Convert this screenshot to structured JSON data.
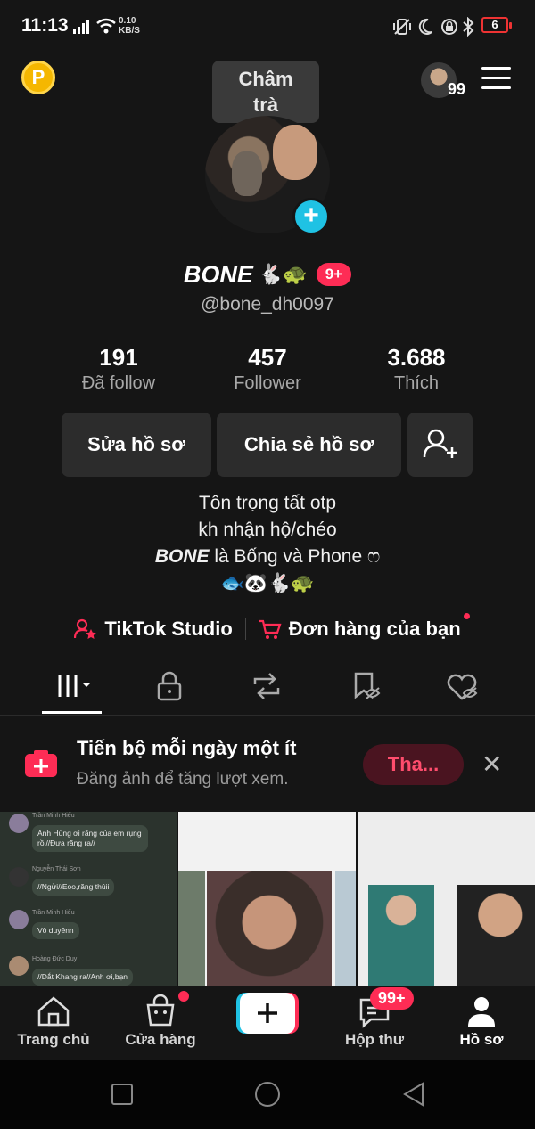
{
  "status_bar": {
    "time": "11:13",
    "speed_value": "0.10",
    "speed_unit": "KB/S",
    "battery": "6"
  },
  "header": {
    "coin_label": "P",
    "tooltip_line1": "Châm",
    "tooltip_line2": "trà",
    "following_count": "99"
  },
  "profile": {
    "name": "BONE",
    "name_emoji": "🐇🐢",
    "badge": "9+",
    "handle": "@bone_dh0097",
    "stats": [
      {
        "value": "191",
        "label": "Đã follow"
      },
      {
        "value": "457",
        "label": "Follower"
      },
      {
        "value": "3.688",
        "label": "Thích"
      }
    ],
    "buttons": {
      "edit": "Sửa hồ sơ",
      "share": "Chia sẻ hồ sơ"
    },
    "bio": {
      "line1": "Tôn trọng tất otp",
      "line2": "kh nhận hộ/chéo",
      "line3_bold": "BONE",
      "line3_rest": " là Bống và Phone ෆ",
      "line4": "🐟🐼🐇🐢"
    },
    "links": {
      "studio": "TikTok Studio",
      "orders": "Đơn hàng của bạn"
    }
  },
  "tabs": [
    "videos-tab",
    "private-tab",
    "repost-tab",
    "saved-tab",
    "liked-tab"
  ],
  "banner": {
    "title": "Tiến bộ mỗi ngày một ít",
    "subtitle": "Đăng ảnh để tăng lượt xem.",
    "button": "Tha..."
  },
  "chat_thumb": {
    "names": [
      "Trần Minh Hiếu",
      "Nguyễn Thái Sơn",
      "Trần Minh Hiếu",
      "Hoàng Đức Duy"
    ],
    "messages": [
      "Anh Hùng ơi răng của em rụng rồi//Đưa răng ra//",
      "//Ngửi//Eoo,răng thúii",
      "Vô duyênn",
      "//Dắt Khang ra//Anh ơi,bạn"
    ]
  },
  "bottom_nav": {
    "home": "Trang chủ",
    "shop": "Cửa hàng",
    "inbox": "Hộp thư",
    "inbox_badge": "99+",
    "profile": "Hồ sơ"
  },
  "colors": {
    "background": "#151515",
    "accent": "#fe2c55",
    "cyan": "#1fc2e4",
    "button_bg": "#2c2c2c"
  }
}
